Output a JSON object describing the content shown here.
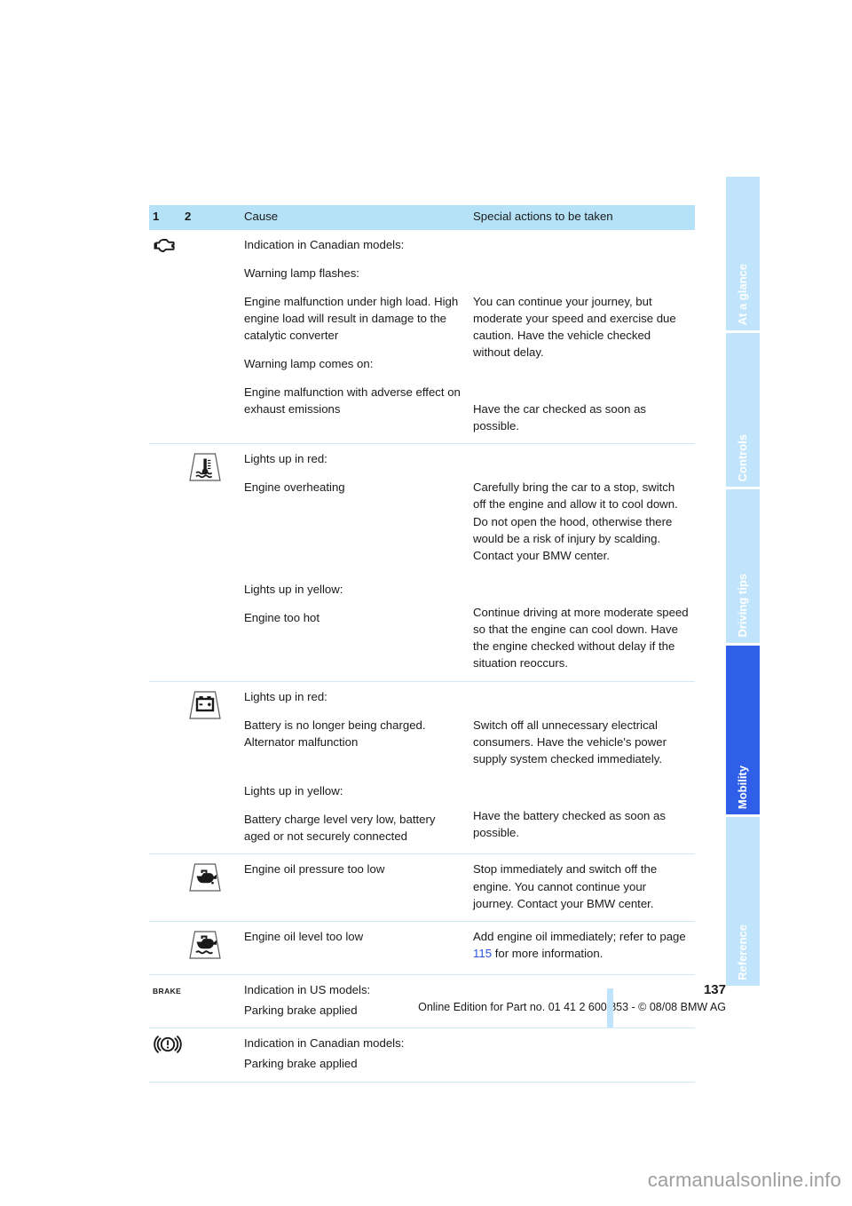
{
  "document": {
    "page_number": "137",
    "edition_line": "Online Edition for Part no. 01 41 2 600 853 - © 08/08 BMW AG",
    "watermark": "carmanualsonline.info"
  },
  "colors": {
    "header_band": "#b5e2f7",
    "tab_inactive": "#bfe4fb",
    "tab_active": "#2f5fe8",
    "row_divider": "#cfe9f8",
    "page_ref_link": "#2b55e0"
  },
  "tab_rail": {
    "tabs": [
      {
        "label": "At a glance",
        "active": false
      },
      {
        "label": "Controls",
        "active": false
      },
      {
        "label": "Driving tips",
        "active": false
      },
      {
        "label": "Mobility",
        "active": true
      },
      {
        "label": "Reference",
        "active": false
      }
    ]
  },
  "table": {
    "headers": {
      "col1": "1",
      "col2": "2",
      "col3": "Cause",
      "col4": "Special actions to be taken"
    },
    "rows": [
      {
        "icon1": "engine-check-icon",
        "icon2": "",
        "cause_blocks": [
          "Indication in Canadian models:",
          "Warning lamp flashes:",
          "Engine malfunction under high load. High engine load will result in damage to the catalytic converter",
          "Warning lamp comes on:",
          "Engine malfunction with adverse effect on exhaust emissions"
        ],
        "action_blocks": [
          "",
          "",
          "You can continue your journey, but moderate your speed and exercise due caution. Have the vehicle checked without delay.",
          "",
          "Have the car checked as soon as possible."
        ]
      },
      {
        "icon1": "",
        "icon2": "coolant-temperature-icon",
        "cause_blocks": [
          "Lights up in red:",
          "Engine overheating",
          "Lights up in yellow:",
          "Engine too hot"
        ],
        "action_blocks": [
          "",
          "Carefully bring the car to a stop, switch off the engine and allow it to cool down. Do not open the hood, otherwise there would be a risk of injury by scalding. Contact your BMW center.",
          "",
          "Continue driving at more moderate speed so that the engine can cool down. Have the engine checked without delay if the situation reoccurs."
        ]
      },
      {
        "icon1": "",
        "icon2": "battery-charge-icon",
        "cause_blocks": [
          "Lights up in red:",
          "Battery is no longer being charged. Alternator malfunction",
          "Lights up in yellow:",
          "Battery charge level very low, battery aged or not securely connected"
        ],
        "action_blocks": [
          "",
          "Switch off all unnecessary electrical consumers. Have the vehicle's power supply system checked immediately.",
          "",
          "Have the battery checked as soon as possible."
        ]
      },
      {
        "icon1": "",
        "icon2": "oil-pressure-icon",
        "cause_blocks": [
          "Engine oil pressure too low"
        ],
        "action_blocks": [
          "Stop immediately and switch off the engine. You cannot continue your journey. Contact your BMW center."
        ]
      },
      {
        "icon1": "",
        "icon2": "oil-level-icon",
        "cause_blocks": [
          "Engine oil level too low"
        ],
        "action_blocks_rich": {
          "before": "Add engine oil immediately; refer to page ",
          "link": "115",
          "after": " for more information."
        }
      },
      {
        "icon1": "brake-word-icon",
        "icon2": "",
        "cause_blocks": [
          "Indication in US models:",
          "Parking brake applied"
        ],
        "action_blocks": [
          "",
          ""
        ]
      },
      {
        "icon1": "brake-circle-icon",
        "icon2": "",
        "cause_blocks": [
          "Indication in Canadian models:",
          "Parking brake applied"
        ],
        "action_blocks": [
          "",
          ""
        ]
      }
    ]
  }
}
